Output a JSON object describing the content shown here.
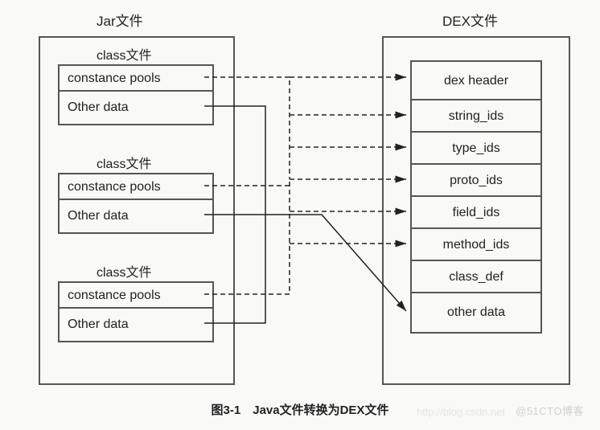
{
  "diagram": {
    "jar_title": "Jar文件",
    "dex_title": "DEX文件",
    "class_label": "class文件",
    "constance_pools": "constance pools",
    "other_data": "Other data",
    "dex": {
      "header": "dex header",
      "string_ids": "string_ids",
      "type_ids": "type_ids",
      "proto_ids": "proto_ids",
      "field_ids": "field_ids",
      "method_ids": "method_ids",
      "class_def": "class_def",
      "other_data": "other data"
    },
    "caption": "图3-1　Java文件转换为DEX文件",
    "watermark_blog": "http://blog.csdn.net",
    "watermark_site": "@51CTO博客"
  }
}
